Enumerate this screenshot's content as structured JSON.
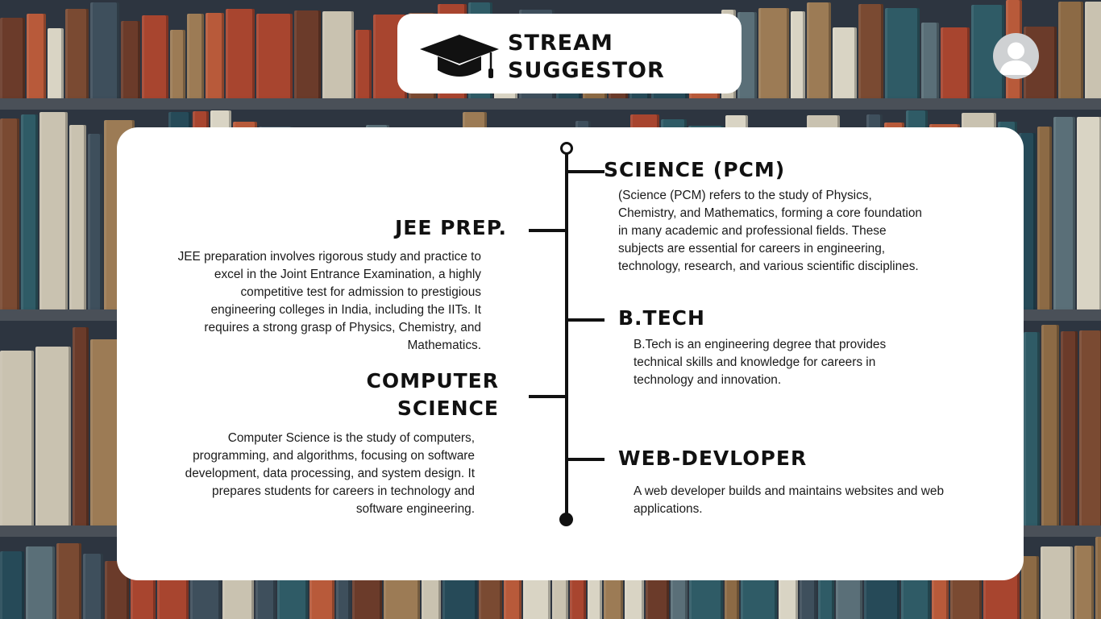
{
  "header": {
    "title": "STREAM\nSUGGESTOR",
    "logo_icon": "graduation-cap-icon"
  },
  "profile": {
    "icon": "user-avatar-icon"
  },
  "timeline": {
    "left": [
      {
        "title": "JEE PREP.",
        "description": "JEE preparation involves rigorous study and practice to excel in the Joint Entrance Examination, a highly competitive test for admission to prestigious engineering colleges in India, including the IITs. It requires a strong grasp of Physics, Chemistry, and Mathematics."
      },
      {
        "title": "COMPUTER\nSCIENCE",
        "description": "Computer Science is the study of computers, programming, and algorithms, focusing on software development, data processing, and system design. It prepares students for careers in technology and software engineering."
      }
    ],
    "right": [
      {
        "title": "SCIENCE (PCM)",
        "description": "(Science (PCM) refers to the study of Physics, Chemistry, and Mathematics, forming a core foundation in many academic and professional fields. These subjects are essential for careers in engineering, technology, research, and various scientific disciplines."
      },
      {
        "title": "B.TECH",
        "description": "B.Tech is an engineering degree that provides technical skills and knowledge for careers in technology and innovation."
      },
      {
        "title": "WEB-DEVLOPER",
        "description": "A web developer builds and maintains websites and web applications."
      }
    ]
  },
  "colors": {
    "accent": "#111111",
    "card": "#ffffff",
    "avatar": "#cfd1d3"
  }
}
